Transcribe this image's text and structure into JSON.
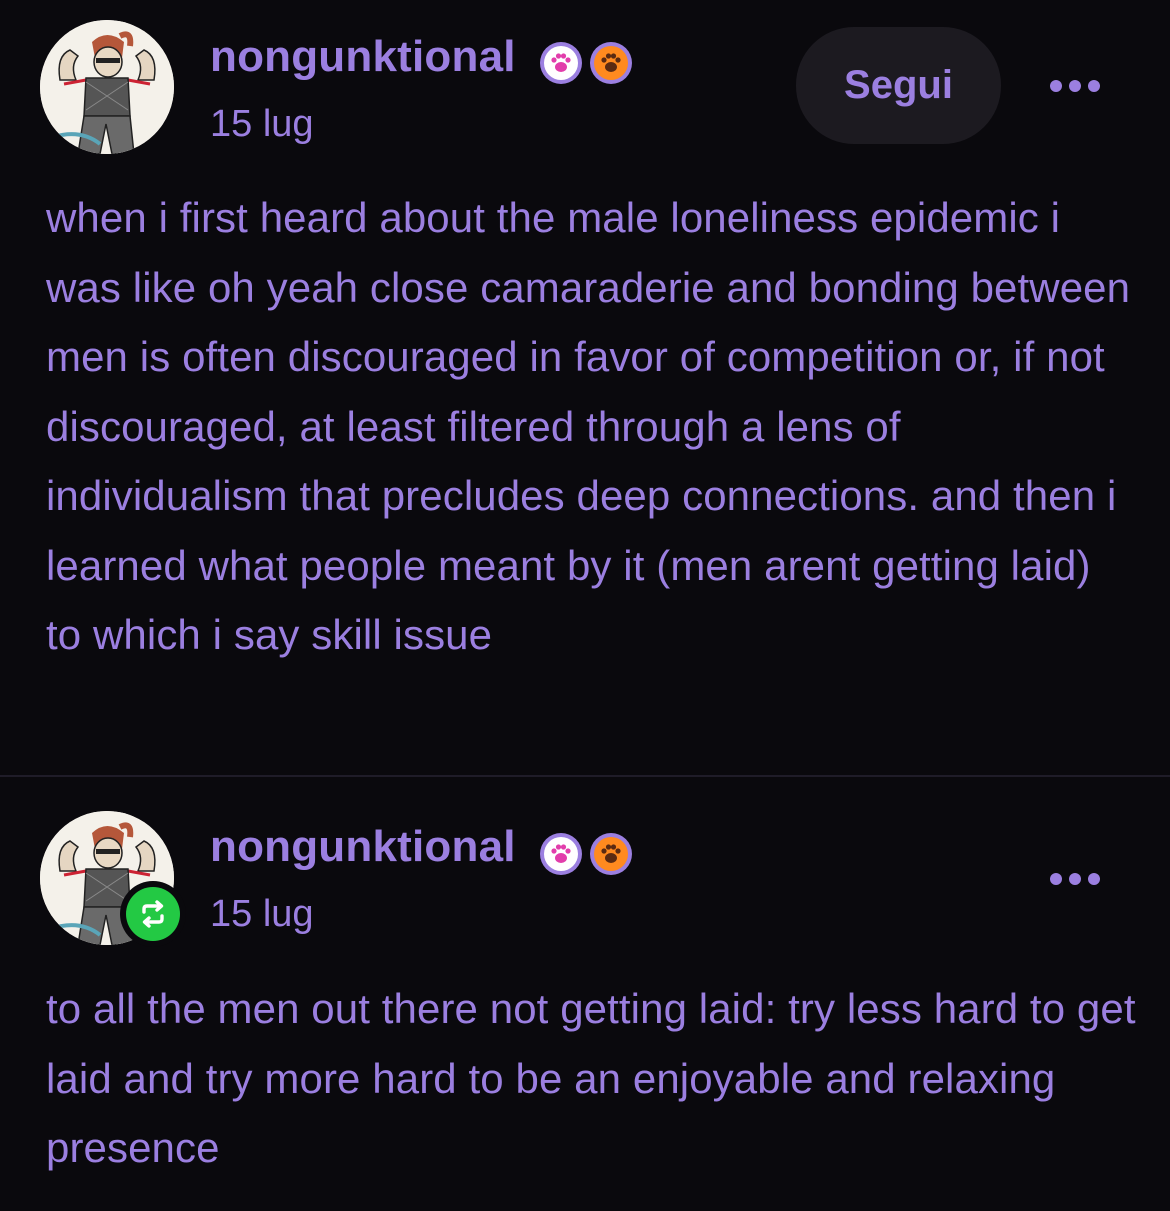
{
  "posts": [
    {
      "username": "nongunktional",
      "timestamp": "15 lug",
      "follow_label": "Segui",
      "body": "when i first heard about the male loneliness epidemic i was like oh yeah close camaraderie and bonding between men is often discouraged in favor of competition or, if not discouraged, at least filtered through a lens of individualism that precludes deep connections. and then i learned what people meant by it (men arent getting laid) to which i say skill issue",
      "badges": [
        "paw-badge-icon-pink",
        "paw-badge-icon-orange"
      ]
    },
    {
      "username": "nongunktional",
      "timestamp": "15 lug",
      "body": "to all the men out there not getting laid: try less hard to get laid and try more hard to be an enjoyable and relaxing presence",
      "badges": [
        "paw-badge-icon-pink",
        "paw-badge-icon-orange"
      ],
      "reblog_icon": "reblog-icon"
    }
  ],
  "colors": {
    "background": "#0a090d",
    "text": "#9b7fe0",
    "button_bg": "#1c1a20",
    "reblog_green": "#23c944"
  }
}
